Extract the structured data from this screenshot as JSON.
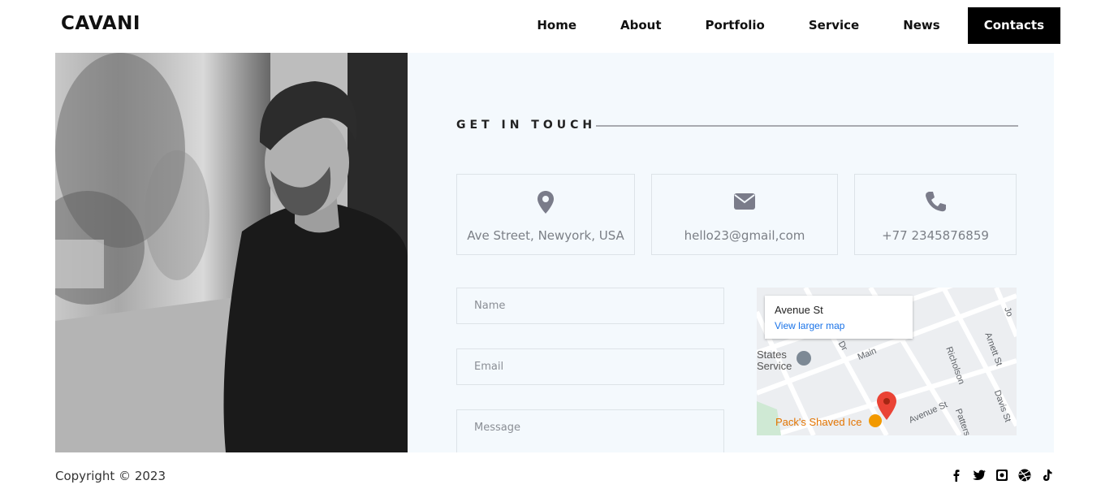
{
  "header": {
    "logo": "CAVANI",
    "nav": [
      {
        "label": "Home"
      },
      {
        "label": "About"
      },
      {
        "label": "Portfolio"
      },
      {
        "label": "Service"
      },
      {
        "label": "News"
      },
      {
        "label": "Contacts",
        "active": true
      }
    ]
  },
  "contact": {
    "heading": "GET IN TOUCH",
    "cards": [
      {
        "icon": "map-marker-icon",
        "text": "Ave Street, Newyork, USA"
      },
      {
        "icon": "envelope-icon",
        "text": "hello23@gmail,com"
      },
      {
        "icon": "phone-icon",
        "text": "+77 2345876859"
      }
    ],
    "form": {
      "name_placeholder": "Name",
      "email_placeholder": "Email",
      "message_placeholder": "Message"
    },
    "map": {
      "place_title": "Avenue St",
      "larger_map_link": "View larger map",
      "labels": {
        "states_service": "States\nService",
        "main": "Main",
        "dr": "Dr",
        "richolson": "Richolson",
        "arnett": "Arnett St",
        "davis": "Davis St",
        "avenue": "Avenue St",
        "patters": "Patters",
        "jo": "Jo",
        "packs": "Pack's Shaved Ice"
      }
    }
  },
  "footer": {
    "copyright": "Copyright © 2023",
    "social": [
      "facebook-icon",
      "twitter-icon",
      "instagram-icon",
      "dribbble-icon",
      "tiktok-icon"
    ]
  },
  "colors": {
    "accent": "#000000",
    "panel_bg": "#f4f9fd",
    "icon": "#7a7c8a",
    "link": "#1a73e8",
    "pin": "#ea4335"
  }
}
